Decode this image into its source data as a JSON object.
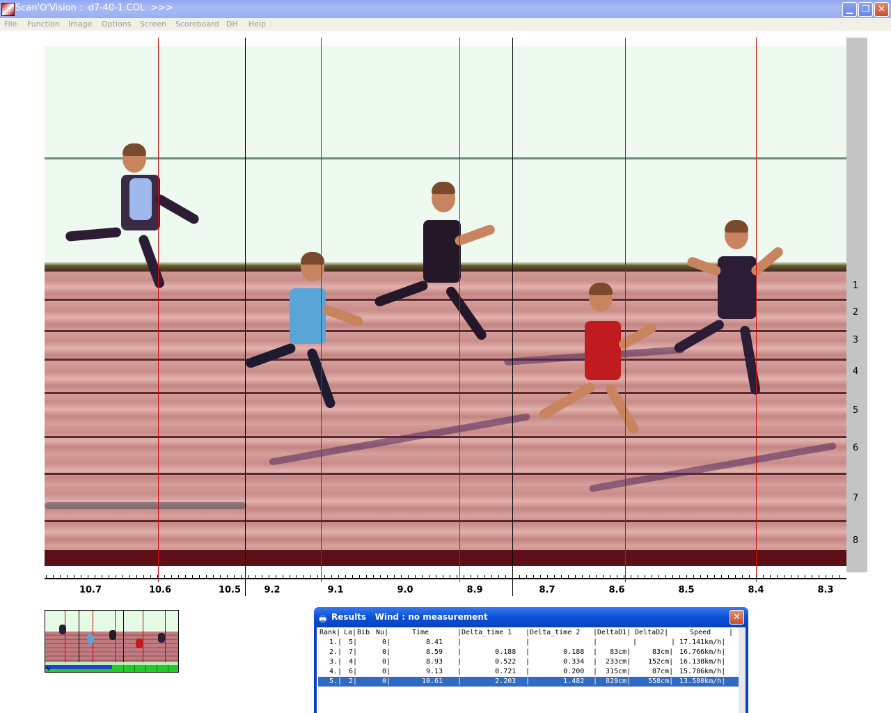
{
  "window": {
    "title": "Scan'O'Vision :  d7-40-1.COL  >>>",
    "min_glyph": "▁",
    "max_glyph": "❐",
    "close_glyph": "✕"
  },
  "menu": [
    "File",
    "Function",
    "Image",
    "Options",
    "Screen",
    "Scoreboard",
    "DH",
    "Help"
  ],
  "lane_numbers": [
    "1",
    "2",
    "3",
    "4",
    "5",
    "6",
    "7",
    "8"
  ],
  "time_axis": {
    "labels": [
      "10.7",
      "10.6",
      "10.5",
      "9.2",
      "9.1",
      "9.0",
      "8.9",
      "8.7",
      "8.6",
      "8.5",
      "8.4",
      "8.3"
    ]
  },
  "colors": {
    "marker_line": "#d01010",
    "selection": "#316ac5",
    "titlebar_blue": "#0a52d8"
  },
  "thumbnail": {
    "mark": "V"
  },
  "results": {
    "icon": "printer-icon",
    "caption": "Results   Wind : no measurement",
    "close_glyph": "✕",
    "header": {
      "rank": "Rank|",
      "lane": "La|",
      "bib": "Bib",
      "nu": "Nu|",
      "time": "Time",
      "delta1": "|Delta_time 1",
      "delta2": "|Delta_time 2",
      "dd1": "|DeltaD1|",
      "dd2": "DeltaD2|",
      "speed": "Speed",
      "end": "|"
    },
    "rows": [
      {
        "rank": "1.|",
        "lane": "5|",
        "nu": "0|",
        "time": "8.41",
        "delta1": "|",
        "delta2": "|",
        "dd1": "|",
        "dd2": "|",
        "speed": "| 17.141km/h|"
      },
      {
        "rank": "2.|",
        "lane": "7|",
        "nu": "0|",
        "time": "8.59",
        "delta1": "|        0.188",
        "delta2": "|        0.188",
        "dd1": "|   83cm|",
        "dd2": "83cm|",
        "speed": " 16.766km/h|"
      },
      {
        "rank": "3.|",
        "lane": "4|",
        "nu": "0|",
        "time": "8.93",
        "delta1": "|        0.522",
        "delta2": "|        0.334",
        "dd1": "|  233cm|",
        "dd2": "152cm|",
        "speed": " 16.138km/h|"
      },
      {
        "rank": "4.|",
        "lane": "6|",
        "nu": "0|",
        "time": "9.13",
        "delta1": "|        0.721",
        "delta2": "|        0.200",
        "dd1": "|  315cm|",
        "dd2": "87cm|",
        "speed": " 15.786km/h|"
      },
      {
        "rank": "5.|",
        "lane": "2|",
        "nu": "0|",
        "time": "10.61",
        "delta1": "|        2.203",
        "delta2": "|        1.482",
        "dd1": "|  829cm|",
        "dd2": "558cm|",
        "speed": " 13.580km/h|"
      }
    ]
  }
}
